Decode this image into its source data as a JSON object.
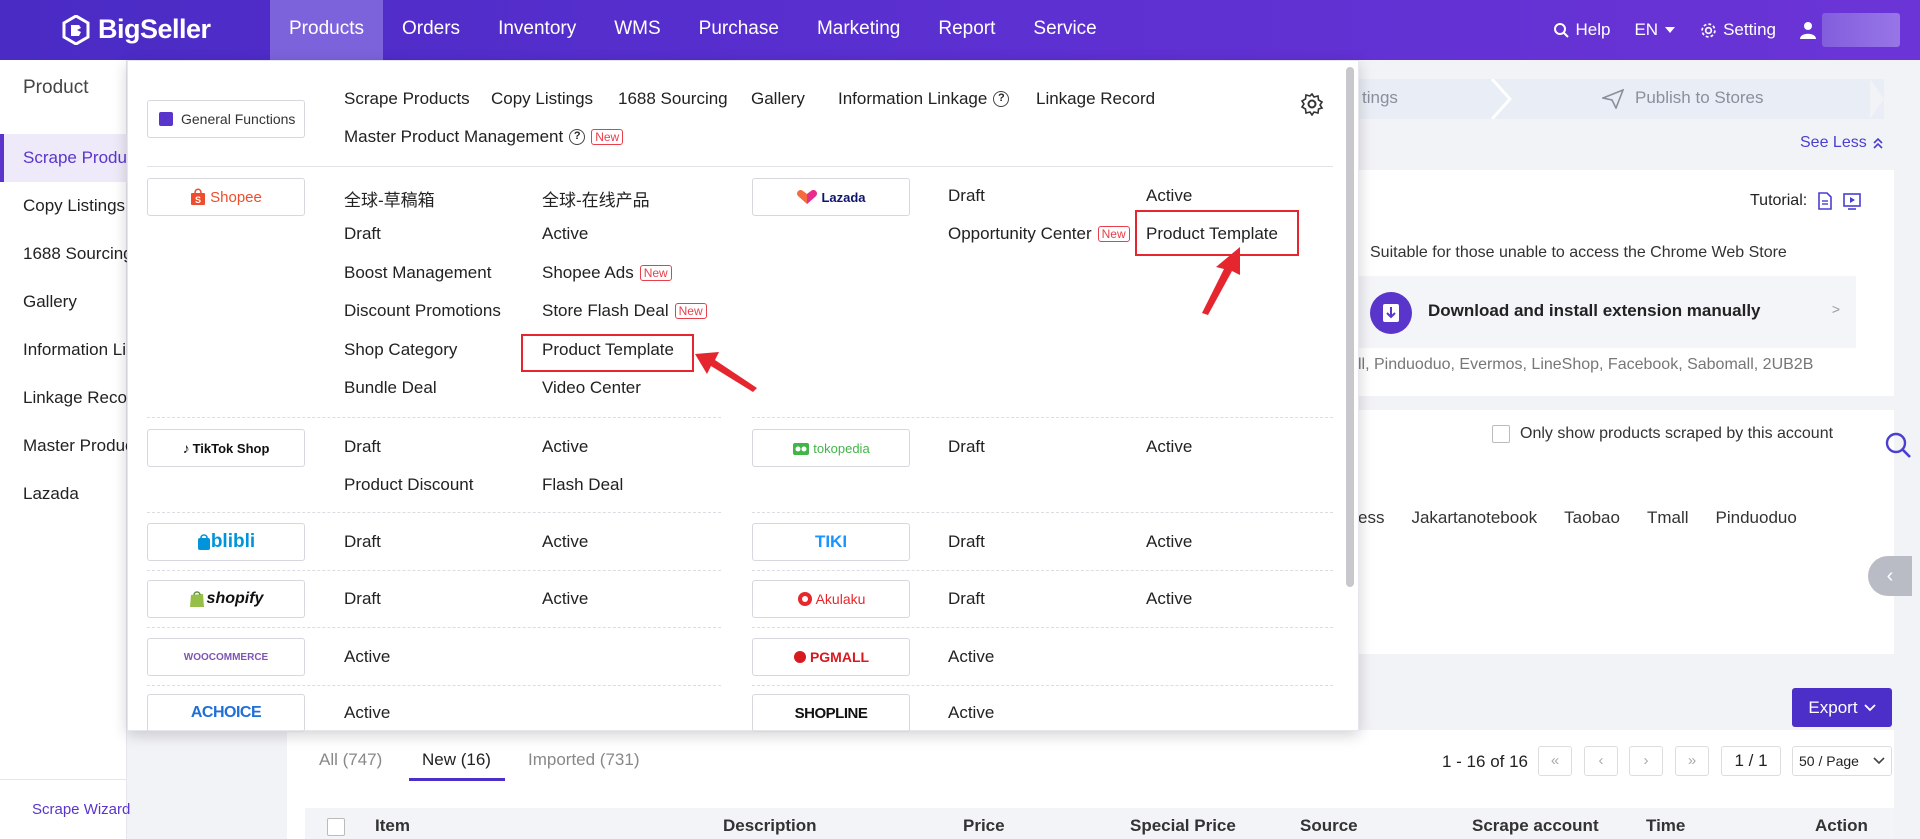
{
  "app": {
    "name": "BigSeller"
  },
  "nav": {
    "items": [
      "Products",
      "Orders",
      "Inventory",
      "WMS",
      "Purchase",
      "Marketing",
      "Report",
      "Service"
    ],
    "help": "Help",
    "lang": "EN",
    "setting": "Setting"
  },
  "sidebar": {
    "title": "Product",
    "items": [
      "Scrape Products",
      "Copy Listings",
      "1688 Sourcing",
      "Gallery",
      "Information Linkage",
      "Linkage Record",
      "Master Product Management",
      "Lazada"
    ],
    "bottom": "Scrape Wizard"
  },
  "background": {
    "step_partial": "tings",
    "step_publish": "Publish to Stores",
    "see_less": "See Less",
    "tutorial": "Tutorial:",
    "suitable": "Suitable for those unable to access the Chrome Web Store",
    "download": "Download and install extension manually",
    "download_arrow": ">",
    "platforms": "ll, Pinduoduo, Evermos, LineShop, Facebook, Sabomall, 2UB2B",
    "only_show": "Only show products scraped by this account",
    "sources": [
      "ess",
      "Jakartanotebook",
      "Taobao",
      "Tmall",
      "Pinduoduo"
    ],
    "collapse": "‹",
    "export": "Export"
  },
  "list": {
    "tabs": [
      "All (747)",
      "New (16)",
      "Imported (731)"
    ],
    "range": "1 - 16 of 16",
    "page": "1 / 1",
    "per_page": "50 / Page",
    "columns": [
      "Item",
      "Description",
      "Price",
      "Special Price",
      "Source",
      "Scrape account",
      "Time",
      "Action"
    ]
  },
  "mega": {
    "general": {
      "button": "General Functions",
      "links": [
        "Scrape Products",
        "Copy Listings",
        "1688 Sourcing",
        "Gallery",
        "Information Linkage",
        "Linkage Record"
      ],
      "master": "Master Product Management",
      "new_badge": "New"
    },
    "shopee": {
      "logo": "Shopee",
      "col1": [
        "全球-草稿箱",
        "Draft",
        "Boost Management",
        "Discount Promotions",
        "Shop Category",
        "Bundle Deal"
      ],
      "col2": [
        "全球-在线产品",
        "Active",
        "Shopee Ads",
        "Store Flash Deal",
        "Product Template",
        "Video Center"
      ]
    },
    "lazada": {
      "logo": "Lazada",
      "col1": [
        "Draft",
        "Opportunity Center"
      ],
      "col2": [
        "Active",
        "Product Template"
      ]
    },
    "tiktok": {
      "logo": "TikTok Shop",
      "col1": [
        "Draft",
        "Product Discount"
      ],
      "col2": [
        "Active",
        "Flash Deal"
      ]
    },
    "tokopedia": {
      "logo": "tokopedia",
      "col1": [
        "Draft"
      ],
      "col2": [
        "Active"
      ]
    },
    "blibli": {
      "logo": "blibli",
      "col1": [
        "Draft"
      ],
      "col2": [
        "Active"
      ]
    },
    "tiki": {
      "logo": "TIKI",
      "col1": [
        "Draft"
      ],
      "col2": [
        "Active"
      ]
    },
    "shopify": {
      "logo": "shopify",
      "col1": [
        "Draft"
      ],
      "col2": [
        "Active"
      ]
    },
    "akulaku": {
      "logo": "Akulaku",
      "col1": [
        "Draft"
      ],
      "col2": [
        "Active"
      ]
    },
    "woocommerce": {
      "logo": "WOOCOMMERCE",
      "col1": [
        "Active"
      ]
    },
    "pgmall": {
      "logo": "PGMALL",
      "col1": [
        "Active"
      ]
    },
    "achoice": {
      "logo": "ACHOICE",
      "col1": [
        "Active"
      ]
    },
    "shopline": {
      "logo": "SHOPLINE",
      "col1": [
        "Active"
      ]
    }
  },
  "colors": {
    "brand": "#5a35cc",
    "highlight": "#e5262f"
  }
}
